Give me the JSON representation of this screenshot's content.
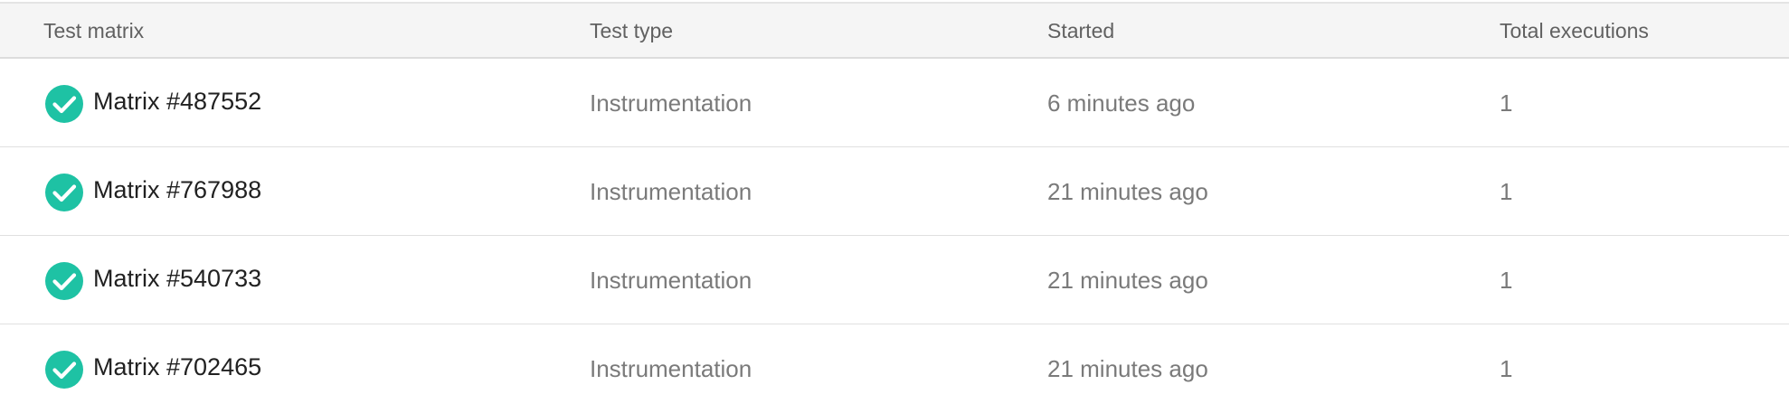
{
  "table": {
    "headers": {
      "test_matrix": "Test matrix",
      "test_type": "Test type",
      "started": "Started",
      "total_executions": "Total executions"
    },
    "rows": [
      {
        "status_icon": "check-circle-icon",
        "name": "Matrix #487552",
        "type": "Instrumentation",
        "started": "6 minutes ago",
        "total": "1"
      },
      {
        "status_icon": "check-circle-icon",
        "name": "Matrix #767988",
        "type": "Instrumentation",
        "started": "21 minutes ago",
        "total": "1"
      },
      {
        "status_icon": "check-circle-icon",
        "name": "Matrix #540733",
        "type": "Instrumentation",
        "started": "21 minutes ago",
        "total": "1"
      },
      {
        "status_icon": "check-circle-icon",
        "name": "Matrix #702465",
        "type": "Instrumentation",
        "started": "21 minutes ago",
        "total": "1"
      }
    ]
  },
  "colors": {
    "success": "#1ec2a4",
    "header_bg": "#f5f5f5",
    "header_text": "#616161",
    "primary_text": "#212121",
    "secondary_text": "#7a7a7a"
  }
}
